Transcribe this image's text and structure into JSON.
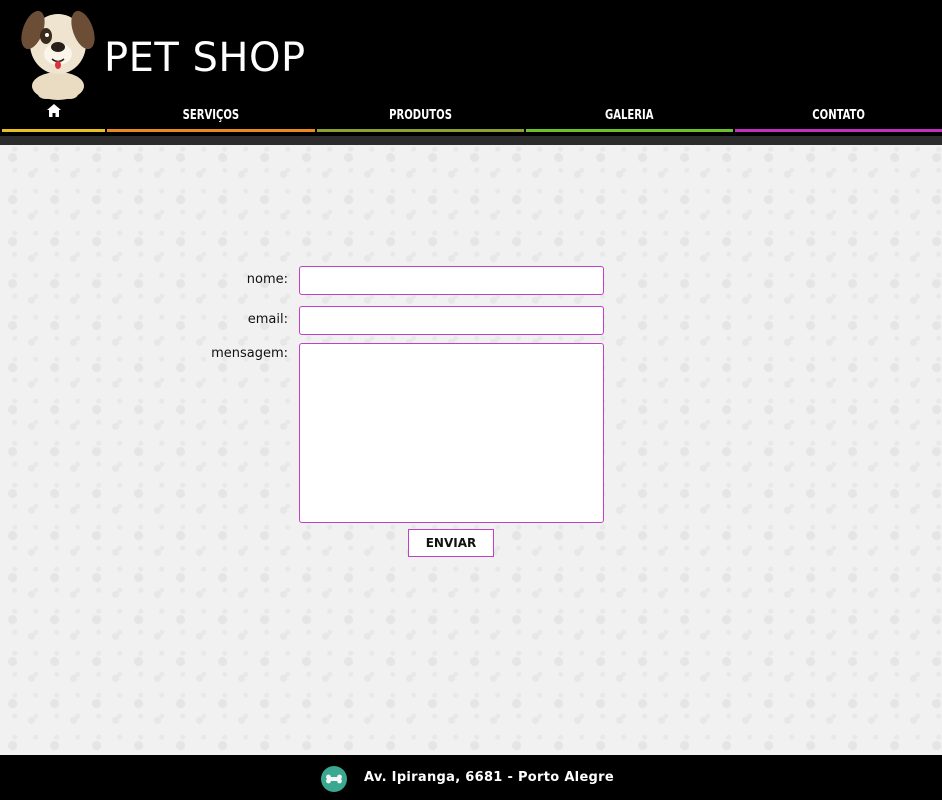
{
  "header": {
    "title": "PET SHOP",
    "logo_icon": "dog-mascot-icon"
  },
  "nav": {
    "items": [
      {
        "id": "home",
        "label": "",
        "icon": "home-icon",
        "color": "#e8c020"
      },
      {
        "id": "servicos",
        "label": "SERVIÇOS",
        "color": "#e88a20"
      },
      {
        "id": "produtos",
        "label": "PRODUTOS",
        "color": "#8ca030"
      },
      {
        "id": "galeria",
        "label": "GALERIA",
        "color": "#6cc030"
      },
      {
        "id": "contato",
        "label": "CONTATO",
        "color": "#c030c0"
      }
    ]
  },
  "form": {
    "name_label": "nome:",
    "name_value": "",
    "email_label": "email:",
    "email_value": "",
    "message_label": "mensagem:",
    "message_value": "",
    "submit_label": "ENVIAR",
    "accent_color": "#c040c8"
  },
  "footer": {
    "address": "Av. Ipiranga, 6681 - Porto Alegre",
    "icon": "bone-icon",
    "icon_color": "#3aa891"
  }
}
